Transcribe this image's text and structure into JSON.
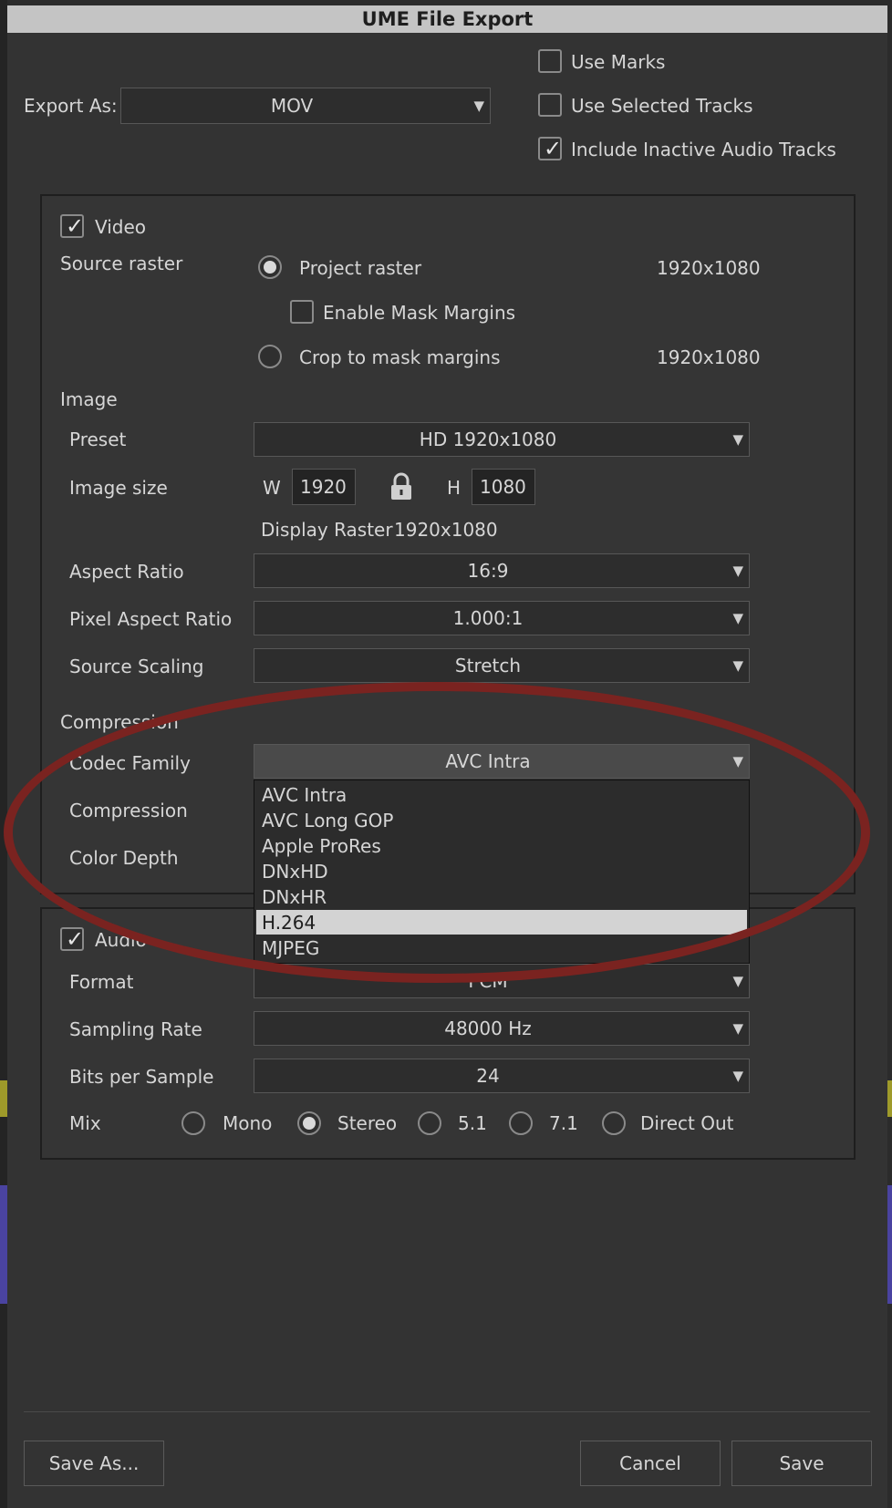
{
  "dialog": {
    "title": "UME File Export"
  },
  "export_as": {
    "label": "Export As:",
    "value": "MOV"
  },
  "options": {
    "use_marks": {
      "label": "Use Marks",
      "checked": false
    },
    "use_selected_tracks": {
      "label": "Use Selected Tracks",
      "checked": false
    },
    "include_inactive_audio": {
      "label": "Include Inactive Audio Tracks",
      "checked": true
    }
  },
  "video": {
    "label": "Video",
    "checked": true,
    "source_raster_label": "Source raster",
    "project_raster": {
      "label": "Project raster",
      "value": "1920x1080",
      "selected": true
    },
    "enable_mask_margins": {
      "label": "Enable Mask Margins",
      "checked": false
    },
    "crop_to_mask": {
      "label": "Crop to mask margins",
      "value": "1920x1080",
      "selected": false
    },
    "image_section": "Image",
    "preset": {
      "label": "Preset",
      "value": "HD 1920x1080"
    },
    "image_size": {
      "label": "Image size",
      "w_label": "W",
      "w": "1920",
      "h_label": "H",
      "h": "1080"
    },
    "display_raster": {
      "label": "Display Raster",
      "value": "1920x1080"
    },
    "aspect_ratio": {
      "label": "Aspect Ratio",
      "value": "16:9"
    },
    "pixel_aspect_ratio": {
      "label": "Pixel Aspect Ratio",
      "value": "1.000:1"
    },
    "source_scaling": {
      "label": "Source Scaling",
      "value": "Stretch"
    },
    "compression_section": "Compression",
    "codec_family": {
      "label": "Codec Family",
      "value": "AVC Intra"
    },
    "compression": {
      "label": "Compression"
    },
    "color_depth": {
      "label": "Color Depth"
    }
  },
  "codec_menu": {
    "items": [
      "AVC Intra",
      "AVC Long GOP",
      "Apple ProRes",
      "DNxHD",
      "DNxHR",
      "H.264",
      "MJPEG"
    ],
    "highlighted": "H.264"
  },
  "audio": {
    "label": "Audio",
    "checked": true,
    "format": {
      "label": "Format",
      "value": "PCM"
    },
    "sampling_rate": {
      "label": "Sampling Rate",
      "value": "48000 Hz"
    },
    "bits_per_sample": {
      "label": "Bits per Sample",
      "value": "24"
    },
    "mix": {
      "label": "Mix",
      "options": [
        "Mono",
        "Stereo",
        "5.1",
        "7.1",
        "Direct Out"
      ],
      "selected": "Stereo"
    }
  },
  "buttons": {
    "save_as": "Save As...",
    "cancel": "Cancel",
    "save": "Save"
  },
  "colors": {
    "annotation": "#7a2320",
    "highlight": "#d3d3d3"
  }
}
